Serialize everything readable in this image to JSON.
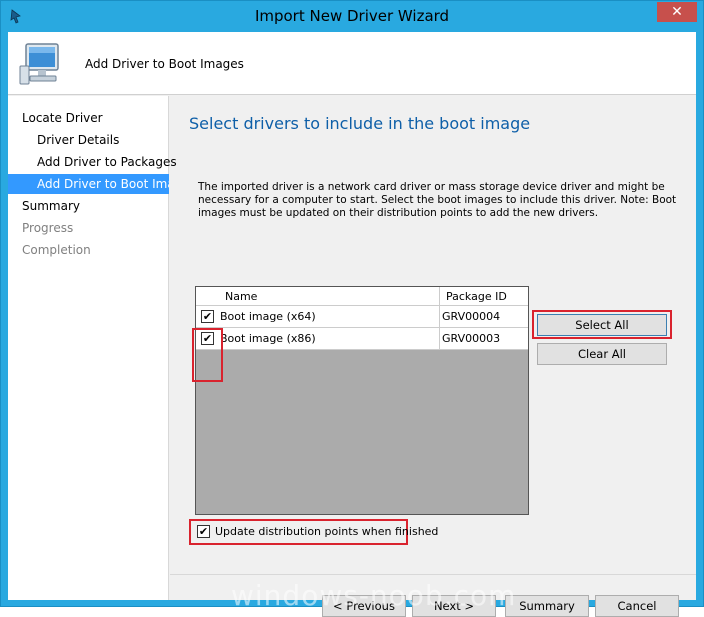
{
  "window": {
    "title": "Import New Driver Wizard",
    "close_label": "✕"
  },
  "header": {
    "title": "Add Driver to Boot Images"
  },
  "nav": {
    "items": [
      {
        "label": "Locate Driver"
      },
      {
        "label": "Driver Details"
      },
      {
        "label": "Add Driver to Packages"
      },
      {
        "label": "Add Driver to Boot Images"
      },
      {
        "label": "Summary"
      },
      {
        "label": "Progress"
      },
      {
        "label": "Completion"
      }
    ]
  },
  "page": {
    "heading": "Select drivers to include in the boot image",
    "description": "The imported driver is a network card driver or mass storage device driver and might be necessary for a computer to start. Select the boot images to include this driver.  Note: Boot images must be updated on their distribution points to add the new drivers."
  },
  "grid": {
    "columns": [
      "Name",
      "Package ID"
    ],
    "rows": [
      {
        "name": "Boot image (x64)",
        "package_id": "GRV00004",
        "checked": true
      },
      {
        "name": "Boot image (x86)",
        "package_id": "GRV00003",
        "checked": true
      }
    ]
  },
  "buttons": {
    "select_all": "Select All",
    "clear_all": "Clear All",
    "previous": "< Previous",
    "next": "Next >",
    "summary": "Summary",
    "cancel": "Cancel"
  },
  "options": {
    "update_dp_label": "Update distribution points when finished",
    "update_dp_checked": true
  },
  "watermark": "windows-noob.com",
  "colors": {
    "accent": "#29a9e0",
    "highlight": "#d9232e",
    "heading": "#0e5fa8",
    "selection": "#3399ff"
  }
}
